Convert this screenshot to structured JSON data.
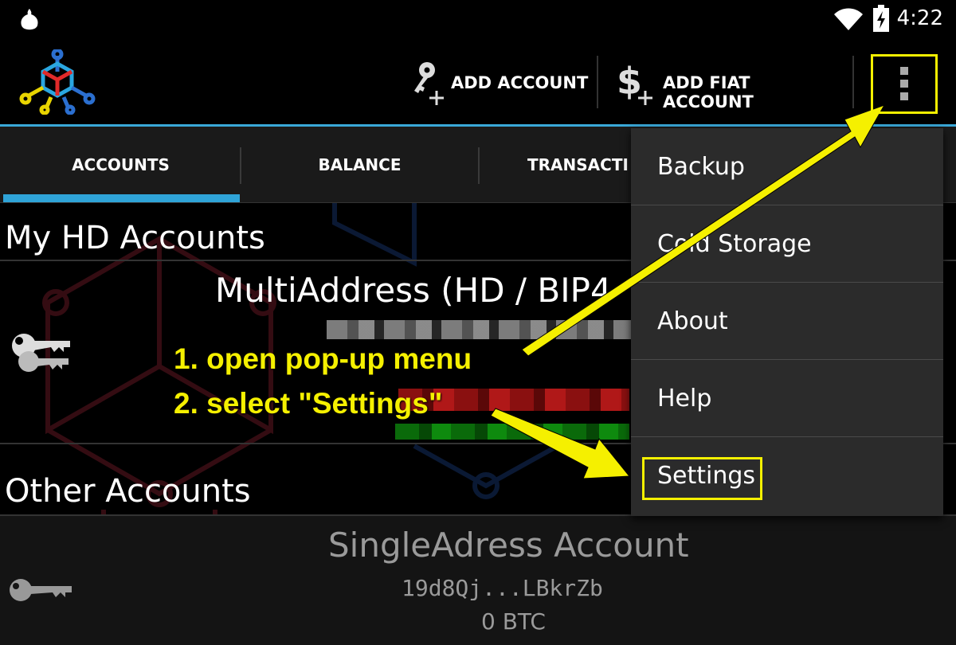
{
  "status_bar": {
    "time": "4:22",
    "left_icon": "onion-notification-icon",
    "wifi_icon": "wifi-icon",
    "battery_icon": "battery-charging-icon"
  },
  "action_bar": {
    "logo_icon": "mycelium-logo-icon",
    "add_account_label": "ADD ACCOUNT",
    "add_account_icon": "key-plus-icon",
    "add_fiat_label": "ADD FIAT ACCOUNT",
    "add_fiat_icon": "dollar-plus-icon",
    "overflow_icon": "overflow-menu-icon"
  },
  "tabs": [
    {
      "label": "ACCOUNTS",
      "selected": true
    },
    {
      "label": "BALANCE",
      "selected": false
    },
    {
      "label": "TRANSACTI",
      "selected": false
    }
  ],
  "content": {
    "hd_header": "My HD Accounts",
    "hd_account_name": "MultiAddress (HD / BIP4",
    "other_header": "Other Accounts",
    "single_account": {
      "name": "SingleAdress Account",
      "address": "19d8Qj...LBkrZb",
      "balance": "0 BTC"
    }
  },
  "menu": {
    "items": [
      {
        "label": "Backup"
      },
      {
        "label": "Cold Storage"
      },
      {
        "label": "About"
      },
      {
        "label": "Help"
      },
      {
        "label": "Settings"
      }
    ]
  },
  "annotations": {
    "step1": "1. open pop-up menu",
    "step2": "2. select \"Settings\"",
    "color": "#f5f000"
  },
  "colors": {
    "accent": "#2fa4d8",
    "background": "#000000",
    "menu_bg": "#2b2b2b"
  }
}
